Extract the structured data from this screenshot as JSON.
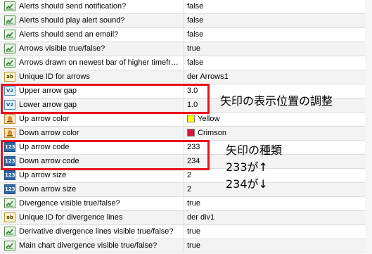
{
  "rows": [
    {
      "name": "Alerts should send notification?",
      "value": "false",
      "type": "bool"
    },
    {
      "name": "Alerts should play alert sound?",
      "value": "false",
      "type": "bool"
    },
    {
      "name": "Alerts should send an email?",
      "value": "false",
      "type": "bool"
    },
    {
      "name": "Arrows visible true/false?",
      "value": "true",
      "type": "bool"
    },
    {
      "name": "Arrows drawn on newest bar of higher timeframe bar?",
      "value": "false",
      "type": "bool"
    },
    {
      "name": "Unique ID for arrows",
      "value": "der Arrows1",
      "type": "str"
    },
    {
      "name": "Upper arrow gap",
      "value": "3.0",
      "type": "dbl"
    },
    {
      "name": "Lower arrow gap",
      "value": "1.0",
      "type": "dbl"
    },
    {
      "name": "Up arrow color",
      "value": "Yellow",
      "type": "col",
      "swatch": "#ffff00"
    },
    {
      "name": "Down arrow color",
      "value": "Crimson",
      "type": "col",
      "swatch": "#dc143c"
    },
    {
      "name": "Up arrow code",
      "value": "233",
      "type": "int"
    },
    {
      "name": "Down arrow code",
      "value": "234",
      "type": "int"
    },
    {
      "name": "Up arrow size",
      "value": "2",
      "type": "int"
    },
    {
      "name": "Down arrow size",
      "value": "2",
      "type": "int"
    },
    {
      "name": "Divergence visible true/false?",
      "value": "true",
      "type": "bool"
    },
    {
      "name": "Unique ID for divergence lines",
      "value": "der div1",
      "type": "str"
    },
    {
      "name": "Derivative divergence lines visible true/false?",
      "value": "true",
      "type": "bool"
    },
    {
      "name": "Main chart divergence visible true/false?",
      "value": "true",
      "type": "bool"
    }
  ],
  "icon_labels": {
    "str": "ab",
    "dbl": "V2",
    "int": "123"
  },
  "annotations": {
    "gap_note": "矢印の表示位置の調整",
    "code_title": "矢印の種類",
    "code_up": "233が↑",
    "code_down": "234が↓"
  },
  "colors": {
    "highlight": "#e8121c"
  }
}
